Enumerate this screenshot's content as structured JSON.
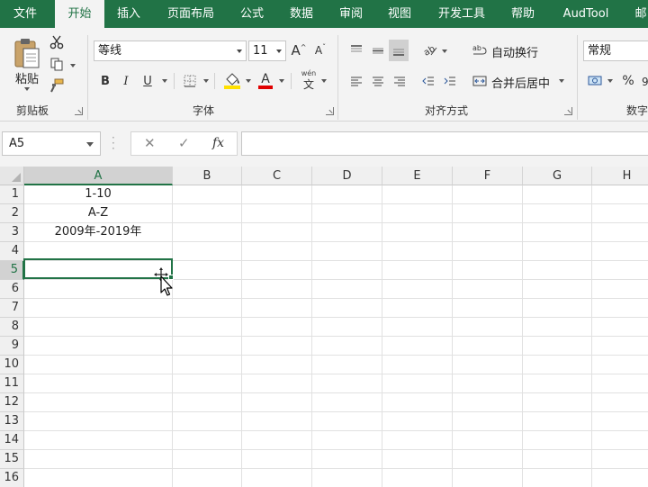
{
  "ribbon_tabs": [
    {
      "label": "文件",
      "active": false
    },
    {
      "label": "开始",
      "active": true
    },
    {
      "label": "插入",
      "active": false
    },
    {
      "label": "页面布局",
      "active": false
    },
    {
      "label": "公式",
      "active": false
    },
    {
      "label": "数据",
      "active": false
    },
    {
      "label": "审阅",
      "active": false
    },
    {
      "label": "视图",
      "active": false
    },
    {
      "label": "开发工具",
      "active": false
    },
    {
      "label": "帮助",
      "active": false
    },
    {
      "label": "AudTool",
      "active": false
    },
    {
      "label": "邮",
      "active": false
    }
  ],
  "clipboard": {
    "paste_label": "粘贴",
    "group_label": "剪贴板"
  },
  "font": {
    "font_name": "等线",
    "font_size": "11",
    "bold": "B",
    "italic": "I",
    "underline": "U",
    "grow": "A",
    "shrink": "A",
    "phonetic_top": "wén",
    "phonetic_bottom": "文",
    "group_label": "字体",
    "font_color": "#e00000",
    "fill_color": "#ffe000"
  },
  "alignment": {
    "wrap_text": "自动换行",
    "merge_center": "合并后居中",
    "group_label": "对齐方式"
  },
  "number": {
    "format": "常规",
    "percent": "%",
    "group_label": "数字"
  },
  "formula_bar": {
    "name_box": "A5",
    "cancel": "✕",
    "enter": "✓",
    "fx": "fx",
    "content": ""
  },
  "sheet": {
    "columns": [
      "A",
      "B",
      "C",
      "D",
      "E",
      "F",
      "G",
      "H"
    ],
    "rows": [
      "1",
      "2",
      "3",
      "4",
      "5",
      "6",
      "7",
      "8",
      "9",
      "10",
      "11",
      "12",
      "13",
      "14",
      "15",
      "16"
    ],
    "selected_column": "A",
    "selected_row": "5",
    "cells": {
      "A1": "1-10",
      "A2": "A-Z",
      "A3": "2009年-2019年"
    }
  },
  "colors": {
    "accent": "#217346",
    "ribbon_bg": "#f3f3f3"
  }
}
